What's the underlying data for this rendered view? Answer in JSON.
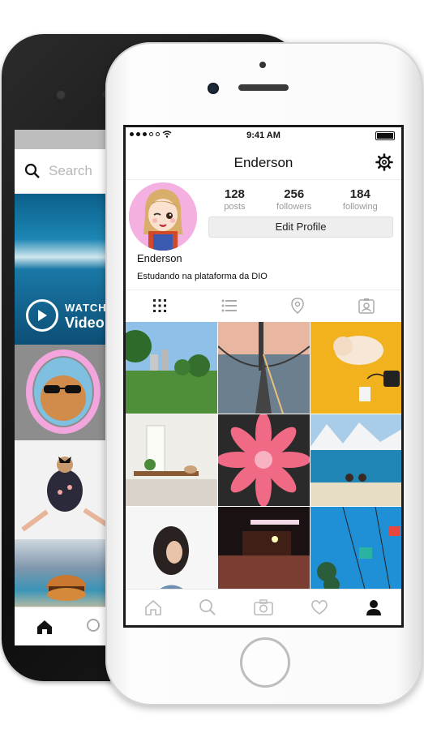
{
  "back_phone": {
    "search_placeholder": "Search",
    "video_label_small": "WATCH",
    "video_label_big": "Video"
  },
  "status_bar": {
    "time": "9:41 AM"
  },
  "header": {
    "title": "Enderson"
  },
  "profile": {
    "stats": [
      {
        "value": "128",
        "label": "posts"
      },
      {
        "value": "256",
        "label": "followers"
      },
      {
        "value": "184",
        "label": "following"
      }
    ],
    "edit_button": "Edit Profile",
    "name": "Enderson",
    "bio": "Estudando na plataforma da DIO"
  },
  "view_tabs": [
    "grid-icon",
    "list-icon",
    "location-pin-icon",
    "tagged-photos-icon"
  ],
  "tab_bar": [
    "home-icon",
    "search-icon",
    "camera-icon",
    "heart-icon",
    "profile-icon"
  ],
  "colors": {
    "avatar_bg": "#f5b0e2",
    "button_bg": "#eeeeee",
    "muted_text": "#9a9a9a"
  }
}
